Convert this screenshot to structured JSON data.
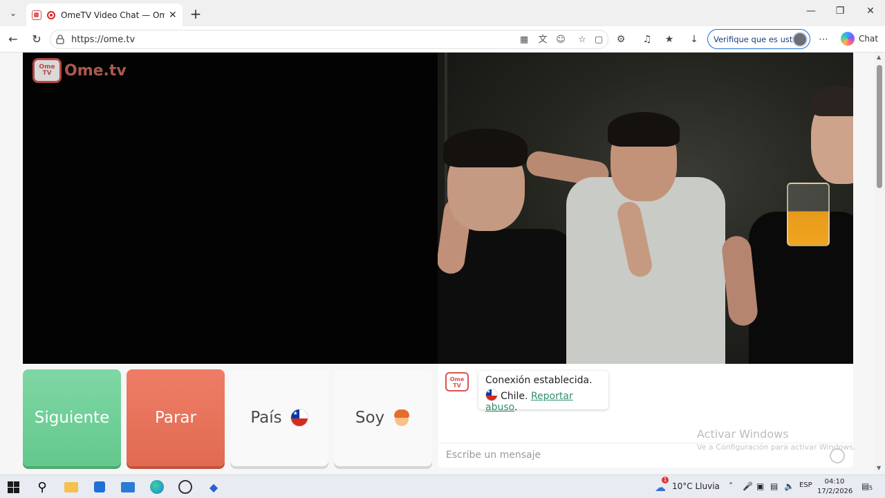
{
  "browser": {
    "tab_title": "OmeTV Video Chat — Omegl",
    "url": "https://ome.tv",
    "verify_label": "Verifique que es usted",
    "chat_label": "Chat",
    "new_tab_glyph": "+",
    "close_tab_glyph": "✕",
    "window_controls": [
      "—",
      "❐",
      "✕"
    ]
  },
  "site": {
    "logo_text": "Ome.tv",
    "logo_badge": "Ome TV"
  },
  "controls": {
    "next": "Siguiente",
    "stop": "Parar",
    "country": "País",
    "me": "Soy"
  },
  "chat": {
    "connection_message": "Conexión establecida.",
    "country_name": "Chile.",
    "report_link": "Reportar abuso",
    "input_placeholder": "Escribe un mensaje"
  },
  "watermark": {
    "line1": "Activar Windows",
    "line2": "Ve a Configuración para activar Windows."
  },
  "taskbar": {
    "weather": "10°C  Lluvia",
    "weather_badge": "1",
    "language": "ESP",
    "time": "04:10",
    "date": "17/2/2026",
    "notification_count": "5"
  },
  "colors": {
    "next_button": "#6fcf97",
    "stop_button": "#e8735b",
    "link": "#2f8f6a",
    "verify_border": "#1b6fd1"
  },
  "icons": [
    "tab-actions-icon",
    "back-icon",
    "refresh-icon",
    "lock-icon",
    "favorite-icon",
    "extensions-icon",
    "downloads-icon",
    "settings-more-icon",
    "windows-start-icon",
    "search-icon",
    "file-explorer-icon",
    "store-icon",
    "mail-icon",
    "edge-icon"
  ]
}
